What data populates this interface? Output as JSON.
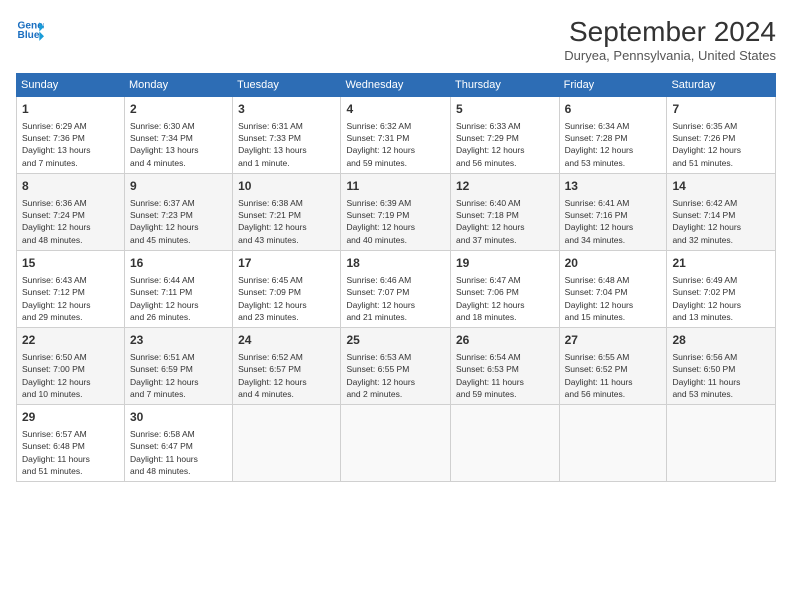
{
  "header": {
    "logo_line1": "General",
    "logo_line2": "Blue",
    "month": "September 2024",
    "location": "Duryea, Pennsylvania, United States"
  },
  "days_of_week": [
    "Sunday",
    "Monday",
    "Tuesday",
    "Wednesday",
    "Thursday",
    "Friday",
    "Saturday"
  ],
  "weeks": [
    [
      {
        "day": "1",
        "info": "Sunrise: 6:29 AM\nSunset: 7:36 PM\nDaylight: 13 hours\nand 7 minutes."
      },
      {
        "day": "2",
        "info": "Sunrise: 6:30 AM\nSunset: 7:34 PM\nDaylight: 13 hours\nand 4 minutes."
      },
      {
        "day": "3",
        "info": "Sunrise: 6:31 AM\nSunset: 7:33 PM\nDaylight: 13 hours\nand 1 minute."
      },
      {
        "day": "4",
        "info": "Sunrise: 6:32 AM\nSunset: 7:31 PM\nDaylight: 12 hours\nand 59 minutes."
      },
      {
        "day": "5",
        "info": "Sunrise: 6:33 AM\nSunset: 7:29 PM\nDaylight: 12 hours\nand 56 minutes."
      },
      {
        "day": "6",
        "info": "Sunrise: 6:34 AM\nSunset: 7:28 PM\nDaylight: 12 hours\nand 53 minutes."
      },
      {
        "day": "7",
        "info": "Sunrise: 6:35 AM\nSunset: 7:26 PM\nDaylight: 12 hours\nand 51 minutes."
      }
    ],
    [
      {
        "day": "8",
        "info": "Sunrise: 6:36 AM\nSunset: 7:24 PM\nDaylight: 12 hours\nand 48 minutes."
      },
      {
        "day": "9",
        "info": "Sunrise: 6:37 AM\nSunset: 7:23 PM\nDaylight: 12 hours\nand 45 minutes."
      },
      {
        "day": "10",
        "info": "Sunrise: 6:38 AM\nSunset: 7:21 PM\nDaylight: 12 hours\nand 43 minutes."
      },
      {
        "day": "11",
        "info": "Sunrise: 6:39 AM\nSunset: 7:19 PM\nDaylight: 12 hours\nand 40 minutes."
      },
      {
        "day": "12",
        "info": "Sunrise: 6:40 AM\nSunset: 7:18 PM\nDaylight: 12 hours\nand 37 minutes."
      },
      {
        "day": "13",
        "info": "Sunrise: 6:41 AM\nSunset: 7:16 PM\nDaylight: 12 hours\nand 34 minutes."
      },
      {
        "day": "14",
        "info": "Sunrise: 6:42 AM\nSunset: 7:14 PM\nDaylight: 12 hours\nand 32 minutes."
      }
    ],
    [
      {
        "day": "15",
        "info": "Sunrise: 6:43 AM\nSunset: 7:12 PM\nDaylight: 12 hours\nand 29 minutes."
      },
      {
        "day": "16",
        "info": "Sunrise: 6:44 AM\nSunset: 7:11 PM\nDaylight: 12 hours\nand 26 minutes."
      },
      {
        "day": "17",
        "info": "Sunrise: 6:45 AM\nSunset: 7:09 PM\nDaylight: 12 hours\nand 23 minutes."
      },
      {
        "day": "18",
        "info": "Sunrise: 6:46 AM\nSunset: 7:07 PM\nDaylight: 12 hours\nand 21 minutes."
      },
      {
        "day": "19",
        "info": "Sunrise: 6:47 AM\nSunset: 7:06 PM\nDaylight: 12 hours\nand 18 minutes."
      },
      {
        "day": "20",
        "info": "Sunrise: 6:48 AM\nSunset: 7:04 PM\nDaylight: 12 hours\nand 15 minutes."
      },
      {
        "day": "21",
        "info": "Sunrise: 6:49 AM\nSunset: 7:02 PM\nDaylight: 12 hours\nand 13 minutes."
      }
    ],
    [
      {
        "day": "22",
        "info": "Sunrise: 6:50 AM\nSunset: 7:00 PM\nDaylight: 12 hours\nand 10 minutes."
      },
      {
        "day": "23",
        "info": "Sunrise: 6:51 AM\nSunset: 6:59 PM\nDaylight: 12 hours\nand 7 minutes."
      },
      {
        "day": "24",
        "info": "Sunrise: 6:52 AM\nSunset: 6:57 PM\nDaylight: 12 hours\nand 4 minutes."
      },
      {
        "day": "25",
        "info": "Sunrise: 6:53 AM\nSunset: 6:55 PM\nDaylight: 12 hours\nand 2 minutes."
      },
      {
        "day": "26",
        "info": "Sunrise: 6:54 AM\nSunset: 6:53 PM\nDaylight: 11 hours\nand 59 minutes."
      },
      {
        "day": "27",
        "info": "Sunrise: 6:55 AM\nSunset: 6:52 PM\nDaylight: 11 hours\nand 56 minutes."
      },
      {
        "day": "28",
        "info": "Sunrise: 6:56 AM\nSunset: 6:50 PM\nDaylight: 11 hours\nand 53 minutes."
      }
    ],
    [
      {
        "day": "29",
        "info": "Sunrise: 6:57 AM\nSunset: 6:48 PM\nDaylight: 11 hours\nand 51 minutes."
      },
      {
        "day": "30",
        "info": "Sunrise: 6:58 AM\nSunset: 6:47 PM\nDaylight: 11 hours\nand 48 minutes."
      },
      {
        "day": "",
        "info": ""
      },
      {
        "day": "",
        "info": ""
      },
      {
        "day": "",
        "info": ""
      },
      {
        "day": "",
        "info": ""
      },
      {
        "day": "",
        "info": ""
      }
    ]
  ]
}
